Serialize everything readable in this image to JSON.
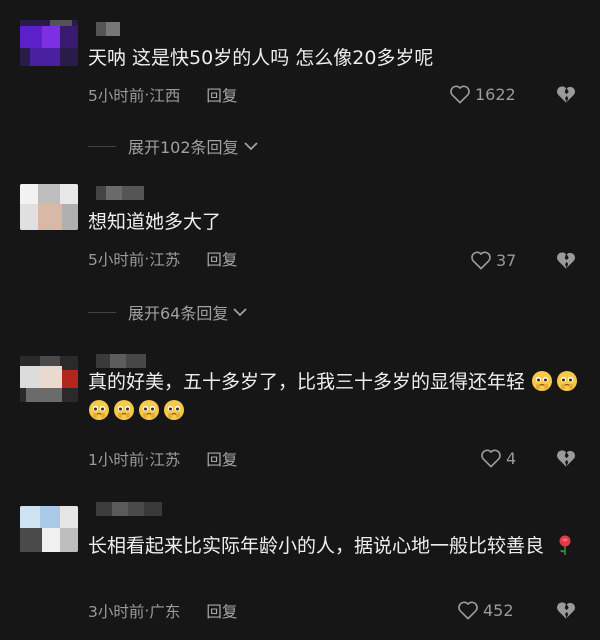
{
  "comments": [
    {
      "text": "天呐 这是快50岁的人吗 怎么像20多岁呢",
      "time": "5小时前",
      "location": "江西",
      "reply_label": "回复",
      "likes": "1622",
      "expand_label": "展开102条回复"
    },
    {
      "text": "想知道她多大了",
      "time": "5小时前",
      "location": "江苏",
      "reply_label": "回复",
      "likes": "37",
      "expand_label": "展开64条回复"
    },
    {
      "text": "真的好美，五十多岁了，比我三十多岁的显得还年轻",
      "time": "1小时前",
      "location": "江苏",
      "reply_label": "回复",
      "likes": "4",
      "emoji_count": 6
    },
    {
      "text": "长相看起来比实际年龄小的人，据说心地一般比较善良",
      "time": "3小时前",
      "location": "广东",
      "reply_label": "回复",
      "likes": "452"
    }
  ],
  "separator": " · ",
  "colors": {
    "background": "#161616",
    "text": "#eeeeee",
    "meta": "#9a9a9a",
    "avatar1_accent": "#6a1bd1"
  }
}
